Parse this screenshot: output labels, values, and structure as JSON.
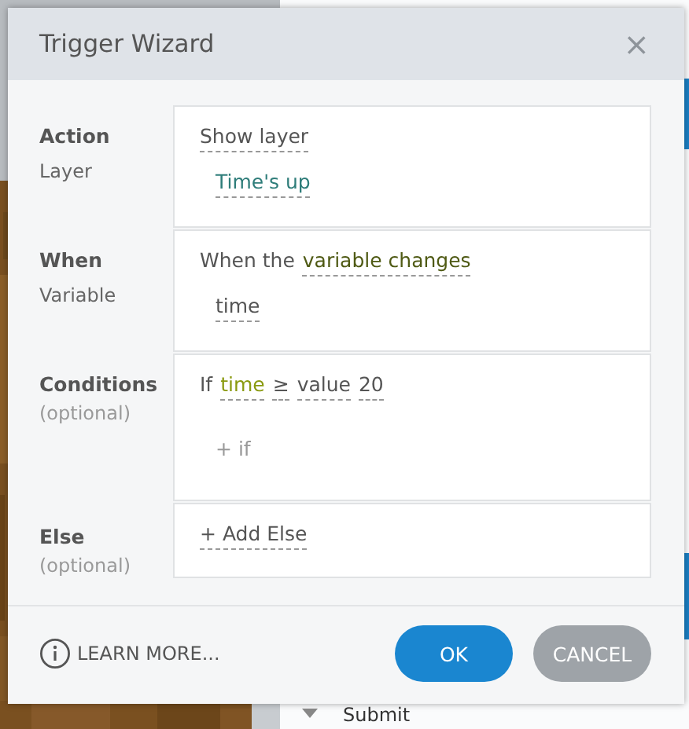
{
  "dialog": {
    "title": "Trigger Wizard",
    "close": "×"
  },
  "sections": [
    {
      "label": "Action",
      "sublabel": "Layer",
      "optional": false,
      "lines": [
        {
          "indented": false,
          "tokens": [
            {
              "text": "Show layer",
              "kind": "option"
            }
          ]
        },
        {
          "indented": true,
          "tokens": [
            {
              "text": "Time's up",
              "kind": "reference",
              "color": "#2f7d7a"
            }
          ]
        }
      ]
    },
    {
      "label": "When",
      "sublabel": "Variable",
      "optional": false,
      "lines": [
        {
          "indented": false,
          "tokens": [
            {
              "text": "When the",
              "kind": "text"
            },
            {
              "text": "variable changes",
              "kind": "reference",
              "color": "#4f5a14"
            }
          ]
        },
        {
          "indented": true,
          "tokens": [
            {
              "text": "time",
              "kind": "option"
            }
          ]
        }
      ]
    },
    {
      "label": "Conditions",
      "sublabel": "(optional)",
      "optional": true,
      "lines": [
        {
          "indented": false,
          "tokens": [
            {
              "text": "If",
              "kind": "text"
            },
            {
              "text": "time",
              "kind": "reference",
              "color": "#8a9a10"
            },
            {
              "text": "≥",
              "kind": "option"
            },
            {
              "text": "value",
              "kind": "option"
            },
            {
              "text": "20",
              "kind": "option"
            }
          ]
        },
        {
          "indented": true,
          "tokens": [
            {
              "text": "+ if",
              "kind": "add"
            }
          ]
        }
      ]
    },
    {
      "label": "Else",
      "sublabel": "(optional)",
      "optional": true,
      "lines": [
        {
          "indented": false,
          "tokens": [
            {
              "text": "+ Add Else",
              "kind": "option"
            }
          ]
        }
      ]
    }
  ],
  "footer": {
    "learn_more": "LEARN MORE...",
    "buttons": [
      {
        "label": "OK",
        "kind": "primary"
      },
      {
        "label": "CANCEL",
        "kind": "secondary"
      }
    ]
  },
  "background": {
    "item": "Submit"
  }
}
